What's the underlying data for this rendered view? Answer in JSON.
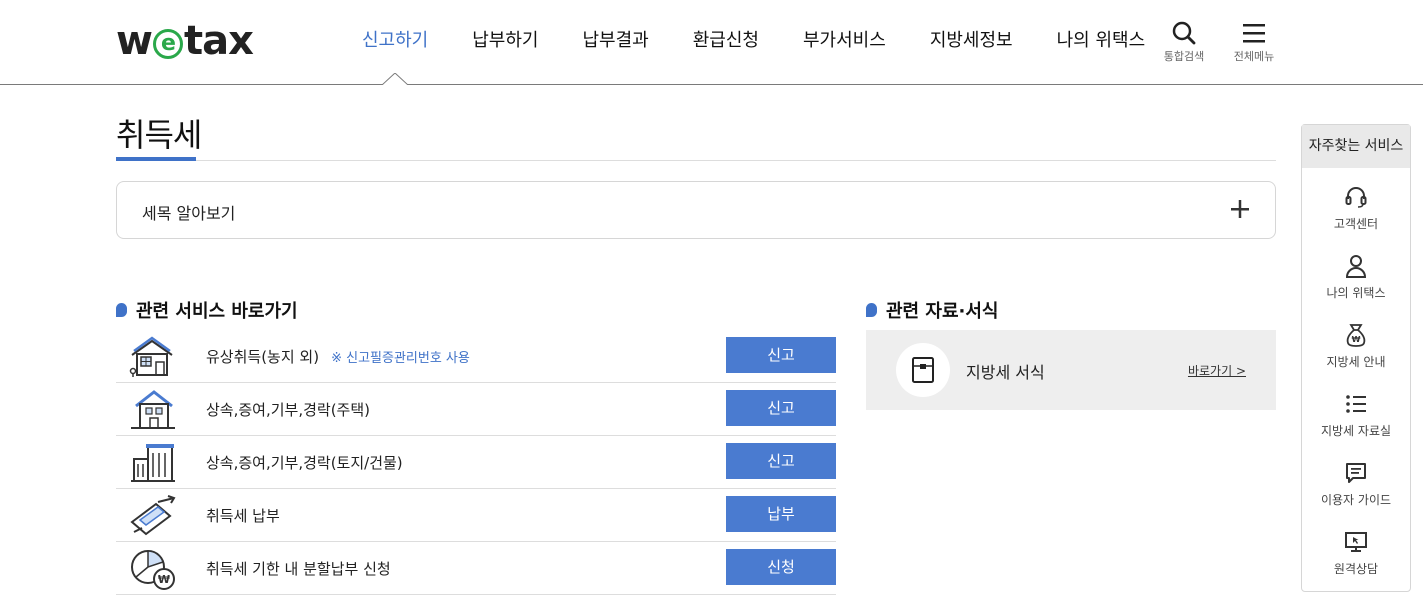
{
  "header": {
    "logo_pre": "w",
    "logo_e": "e",
    "logo_post": "tax",
    "nav": [
      "신고하기",
      "납부하기",
      "납부결과",
      "환급신청",
      "부가서비스",
      "지방세정보",
      "나의 위택스"
    ],
    "active_nav": "신고하기",
    "search_label": "통합검색",
    "menu_label": "전체메뉴"
  },
  "page": {
    "title": "취득세",
    "accordion_label": "세목 알아보기"
  },
  "services": {
    "section_title": "관련 서비스 바로가기",
    "items": [
      {
        "name": "유상취득(농지 외)",
        "note": "※ 신고필증관리번호 사용",
        "button": "신고",
        "icon": "house-plot-icon"
      },
      {
        "name": "상속,증여,기부,경락(주택)",
        "note": "",
        "button": "신고",
        "icon": "house-icon"
      },
      {
        "name": "상속,증여,기부,경락(토지/건물)",
        "note": "",
        "button": "신고",
        "icon": "building-icon"
      },
      {
        "name": "취득세 납부",
        "note": "",
        "button": "납부",
        "icon": "payment-icon"
      },
      {
        "name": "취득세 기한 내 분할납부 신청",
        "note": "",
        "button": "신청",
        "icon": "pie-won-icon"
      }
    ]
  },
  "resources": {
    "section_title": "관련 자료·서식",
    "item_label": "지방세 서식",
    "link_label": "바로가기 >"
  },
  "quick": {
    "title": "자주찾는 서비스",
    "items": [
      {
        "label": "고객센터",
        "icon": "headset-icon"
      },
      {
        "label": "나의 위택스",
        "icon": "person-icon"
      },
      {
        "label": "지방세 안내",
        "icon": "money-bag-icon"
      },
      {
        "label": "지방세 자료실",
        "icon": "list-icon"
      },
      {
        "label": "이용자 가이드",
        "icon": "chat-icon"
      },
      {
        "label": "원격상담",
        "icon": "monitor-icon"
      }
    ]
  },
  "colors": {
    "accent": "#3f72c8",
    "button": "#4a7bd0",
    "logo_e": "#2aa84a"
  }
}
